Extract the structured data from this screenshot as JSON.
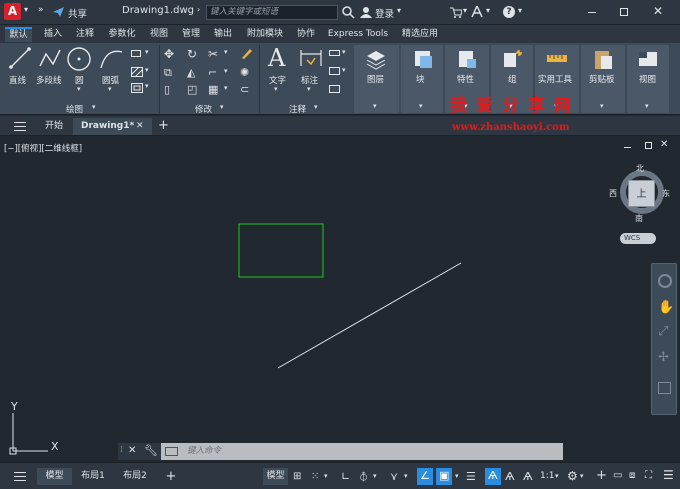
{
  "titlebar": {
    "share_label": "共享",
    "file_name": "Drawing1.dwg",
    "search_placeholder": "键入关键字或短语",
    "login_label": "登录"
  },
  "ribbon_tabs": [
    "默认",
    "插入",
    "注释",
    "参数化",
    "视图",
    "管理",
    "输出",
    "附加模块",
    "协作",
    "Express Tools",
    "精选应用"
  ],
  "ribbon": {
    "draw": {
      "panel_label": "绘图",
      "line": "直线",
      "polyline": "多段线",
      "circle": "圆",
      "arc": "圆弧"
    },
    "modify": {
      "panel_label": "修改"
    },
    "annotation": {
      "panel_label": "注释",
      "text": "文字",
      "dimension": "标注"
    },
    "layers": "图层",
    "block": "块",
    "properties": "特性",
    "groups": "组",
    "utilities": "实用工具",
    "clipboard": "剪贴板",
    "view": "视图"
  },
  "doc_tabs": {
    "start": "开始",
    "drawing": "Drawing1*"
  },
  "viewport": {
    "label": "[−][俯视][二维线框]"
  },
  "viewcube": {
    "north": "北",
    "south": "南",
    "east": "东",
    "west": "西",
    "top": "上",
    "wcs": "WCS"
  },
  "ucs": {
    "x": "X",
    "y": "Y"
  },
  "command_line": {
    "placeholder": "键入命令"
  },
  "status": {
    "model_tab": "模型",
    "layout1": "布局1",
    "layout2": "布局2",
    "model_button": "模型",
    "scale": "1:1"
  },
  "watermark": {
    "line1": "我爱分享网",
    "line2": "www.zhanshaoyi.com"
  },
  "colors": {
    "accent": "#2b8de0",
    "rectangle": "#22c422",
    "logo": "#d8202c",
    "watermark": "#e11b1b"
  }
}
